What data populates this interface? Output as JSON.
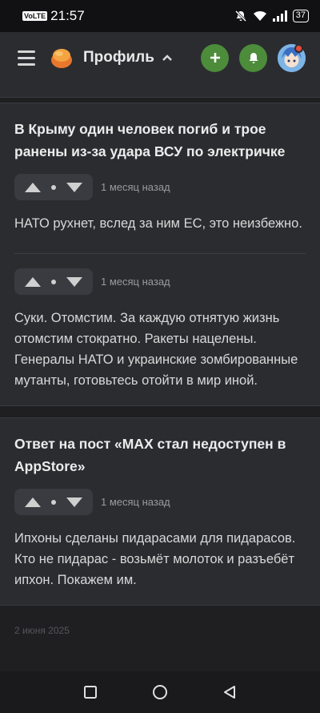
{
  "statusbar": {
    "volte": "VoLTE",
    "time": "21:57",
    "battery": "37"
  },
  "header": {
    "title": "Профиль"
  },
  "cards": [
    {
      "title": "В Крыму один человек погиб и трое ранены из-за удара ВСУ по электричке",
      "comments": [
        {
          "time": "1 месяц назад",
          "text": "НАТО рухнет, вслед за ним ЕС, это неизбежно."
        },
        {
          "time": "1 месяц назад",
          "text": "Суки. Отомстим. За каждую отнятую жизнь отомстим стократно. Ракеты нацелены. Генералы НАТО и украинские зомбированные мутанты, готовьтесь отойти в мир иной."
        }
      ]
    },
    {
      "title": "Ответ на пост «MAX стал недоступен в AppStore»",
      "comments": [
        {
          "time": "1 месяц назад",
          "text": "Ипхоны сделаны пидарасами для пидарасов. Кто не пидарас - возьмёт молоток и разъебёт ипхон. Покажем им."
        }
      ]
    }
  ],
  "footer_date": "2 июня 2025"
}
